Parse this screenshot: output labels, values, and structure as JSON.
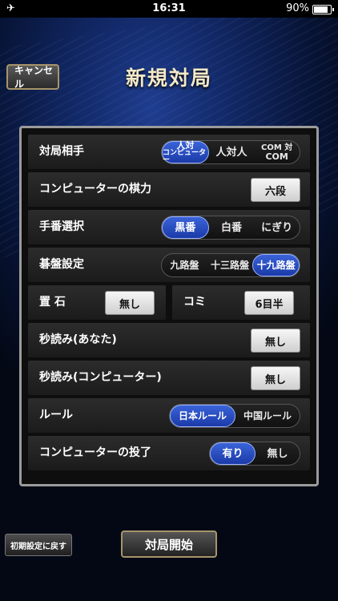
{
  "status_bar": {
    "time": "16:31",
    "battery": "90%"
  },
  "header": {
    "cancel_label": "キャンセル",
    "title": "新規対局"
  },
  "settings": {
    "opponent": {
      "label": "対局相手",
      "opt1_top": "人対",
      "opt1_bottom": "コンピューター",
      "opt2": "人対人",
      "opt3_top": "COM 対",
      "opt3_bottom": "COM",
      "selected": 0
    },
    "com_strength": {
      "label": "コンピューターの棋力",
      "value": "六段"
    },
    "turn": {
      "label": "手番選択",
      "options": [
        "黒番",
        "白番",
        "にぎり"
      ],
      "selected": 0
    },
    "board": {
      "label": "碁盤設定",
      "options": [
        "九路盤",
        "十三路盤",
        "十九路盤"
      ],
      "selected": 2
    },
    "handicap": {
      "label": "置 石",
      "value": "無し"
    },
    "komi": {
      "label": "コミ",
      "value": "6目半"
    },
    "byoyomi_you": {
      "label": "秒読み(あなた)",
      "value": "無し"
    },
    "byoyomi_com": {
      "label": "秒読み(コンピューター)",
      "value": "無し"
    },
    "rules": {
      "label": "ルール",
      "options": [
        "日本ルール",
        "中国ルール"
      ],
      "selected": 0
    },
    "com_resign": {
      "label": "コンピューターの投了",
      "options": [
        "有り",
        "無し"
      ],
      "selected": 0
    }
  },
  "footer": {
    "reset_label": "初期設定に戻す",
    "start_label": "対局開始"
  }
}
